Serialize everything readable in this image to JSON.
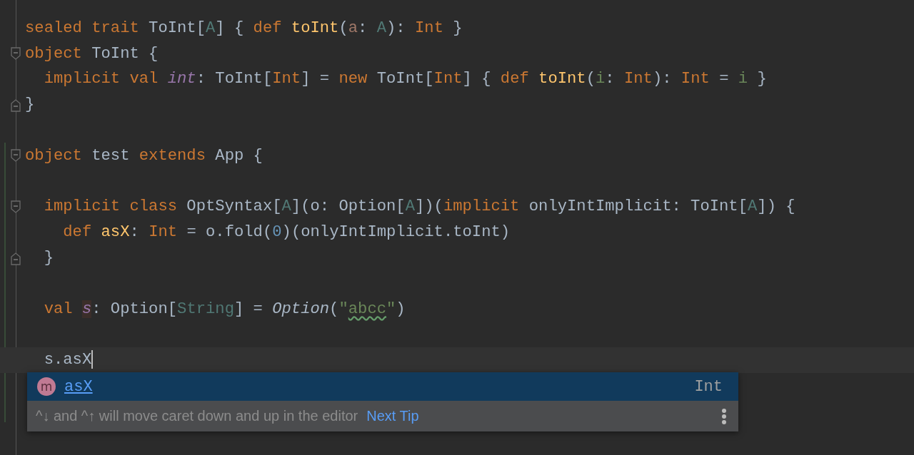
{
  "editor": {
    "lines": [
      {
        "kind": "code",
        "tokens": [
          {
            "t": "sealed trait ",
            "kind": "kw"
          },
          {
            "t": "ToInt[",
            "kind": "plain"
          },
          {
            "t": "A",
            "kind": "tparam"
          },
          {
            "t": "] { ",
            "kind": "plain"
          },
          {
            "t": "def ",
            "kind": "kw"
          },
          {
            "t": "toInt",
            "kind": "fn"
          },
          {
            "t": "(",
            "kind": "plain"
          },
          {
            "t": "a",
            "kind": "param"
          },
          {
            "t": ": ",
            "kind": "plain"
          },
          {
            "t": "A",
            "kind": "tparam"
          },
          {
            "t": "): ",
            "kind": "plain"
          },
          {
            "t": "Int",
            "kind": "kw"
          },
          {
            "t": " }",
            "kind": "plain"
          }
        ]
      },
      {
        "kind": "foldstart",
        "tokens": [
          {
            "t": "object ",
            "kind": "kw"
          },
          {
            "t": "ToInt {",
            "kind": "plain"
          }
        ]
      },
      {
        "kind": "code",
        "tokens": [
          {
            "t": "  implicit val ",
            "kind": "kw"
          },
          {
            "t": "int",
            "kind": "field"
          },
          {
            "t": ": ToInt[",
            "kind": "plain"
          },
          {
            "t": "Int",
            "kind": "kw"
          },
          {
            "t": "] = ",
            "kind": "plain"
          },
          {
            "t": "new ",
            "kind": "kw"
          },
          {
            "t": "ToInt[",
            "kind": "plain"
          },
          {
            "t": "Int",
            "kind": "kw"
          },
          {
            "t": "] { ",
            "kind": "plain"
          },
          {
            "t": "def ",
            "kind": "kw"
          },
          {
            "t": "toInt",
            "kind": "fn"
          },
          {
            "t": "(",
            "kind": "plain"
          },
          {
            "t": "i",
            "kind": "local"
          },
          {
            "t": ": ",
            "kind": "plain"
          },
          {
            "t": "Int",
            "kind": "kw"
          },
          {
            "t": "): ",
            "kind": "plain"
          },
          {
            "t": "Int",
            "kind": "kw"
          },
          {
            "t": " = ",
            "kind": "plain"
          },
          {
            "t": "i",
            "kind": "local"
          },
          {
            "t": " }",
            "kind": "plain"
          }
        ]
      },
      {
        "kind": "foldend",
        "tokens": [
          {
            "t": "}",
            "kind": "plain"
          }
        ]
      },
      {
        "kind": "blank"
      },
      {
        "kind": "foldstart",
        "tokens": [
          {
            "t": "object ",
            "kind": "kw"
          },
          {
            "t": "test ",
            "kind": "plain"
          },
          {
            "t": "extends ",
            "kind": "kw"
          },
          {
            "t": "App {",
            "kind": "plain"
          }
        ]
      },
      {
        "kind": "blank"
      },
      {
        "kind": "foldstart",
        "tokens": [
          {
            "t": "  implicit class ",
            "kind": "kw"
          },
          {
            "t": "OptSyntax[",
            "kind": "plain"
          },
          {
            "t": "A",
            "kind": "tparam"
          },
          {
            "t": "](o: Option[",
            "kind": "plain"
          },
          {
            "t": "A",
            "kind": "tparam"
          },
          {
            "t": "])(",
            "kind": "plain"
          },
          {
            "t": "implicit ",
            "kind": "kw"
          },
          {
            "t": "onlyIntImplicit: ToInt[",
            "kind": "plain"
          },
          {
            "t": "A",
            "kind": "tparam"
          },
          {
            "t": "]) {",
            "kind": "plain"
          }
        ]
      },
      {
        "kind": "code",
        "tokens": [
          {
            "t": "    def ",
            "kind": "kw"
          },
          {
            "t": "asX",
            "kind": "fn"
          },
          {
            "t": ": ",
            "kind": "plain"
          },
          {
            "t": "Int",
            "kind": "kw"
          },
          {
            "t": " = o.fold(",
            "kind": "plain"
          },
          {
            "t": "0",
            "kind": "num"
          },
          {
            "t": ")(onlyIntImplicit.toInt)",
            "kind": "plain"
          }
        ]
      },
      {
        "kind": "foldend",
        "tokens": [
          {
            "t": "  }",
            "kind": "plain"
          }
        ]
      },
      {
        "kind": "blank"
      },
      {
        "kind": "code",
        "tokens": [
          {
            "t": "  val ",
            "kind": "kw"
          },
          {
            "t": "s",
            "kind": "highlight"
          },
          {
            "t": ": Option[",
            "kind": "plain"
          },
          {
            "t": "String",
            "kind": "tparam"
          },
          {
            "t": "] = ",
            "kind": "plain"
          },
          {
            "t": "Option",
            "kind": "italic"
          },
          {
            "t": "(",
            "kind": "plain"
          },
          {
            "t": "\"",
            "kind": "str"
          },
          {
            "t": "abcc",
            "kind": "typo"
          },
          {
            "t": "\"",
            "kind": "str"
          },
          {
            "t": ")",
            "kind": "plain"
          }
        ]
      },
      {
        "kind": "blank"
      },
      {
        "kind": "code",
        "current": true,
        "tokens": [
          {
            "t": "  s.asX",
            "kind": "plain"
          }
        ]
      }
    ]
  },
  "completion": {
    "items": [
      {
        "icon": "m",
        "name": "asX",
        "type": "Int",
        "selected": true
      }
    ],
    "tip": {
      "text": "^↓ and ^↑ will move caret down and up in the editor",
      "link": "Next Tip"
    }
  }
}
